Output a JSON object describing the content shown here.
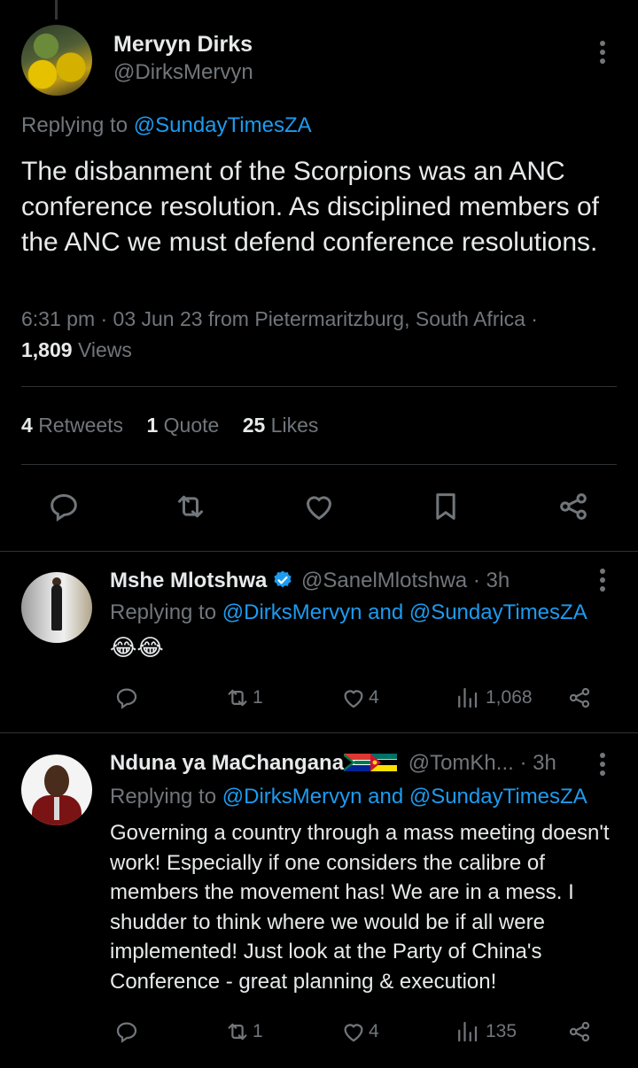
{
  "main_tweet": {
    "name": "Mervyn Dirks",
    "handle": "@DirksMervyn",
    "replying_prefix": "Replying to",
    "replying_to": "@SundayTimesZA",
    "text": "The disbanment of the Scorpions was an ANC conference resolution. As disciplined members of the ANC we must defend conference resolutions.",
    "meta": "6:31 pm · 03 Jun 23 from Pietermaritzburg, South Africa ·",
    "views_count": "1,809",
    "views_label": "Views",
    "stats": {
      "retweets_count": "4",
      "retweets_label": "Retweets",
      "quotes_count": "1",
      "quotes_label": "Quote",
      "likes_count": "25",
      "likes_label": "Likes"
    },
    "icons": [
      "reply-icon",
      "retweet-icon",
      "like-icon",
      "bookmark-icon",
      "share-icon"
    ]
  },
  "replies": [
    {
      "name": "Mshe Mlotshwa",
      "handle": "@SanelMlotshwa",
      "time": "· 3h",
      "verified": true,
      "replying_prefix": "Replying to",
      "replying_to": "@DirksMervyn and @SundayTimesZA",
      "text": "😂😂",
      "retweets": "1",
      "likes": "4",
      "views": "1,068"
    },
    {
      "name": "Nduna ya MaChangana",
      "handle": "@TomKh...",
      "time": "· 3h",
      "verified": false,
      "replying_prefix": "Replying to",
      "replying_to": "@DirksMervyn and @SundayTimesZA",
      "text": "Governing a country through a mass meeting doesn't work! Especially if one considers the calibre of members the movement has! We are in a mess. I shudder to think where we would be if all were implemented! Just look at the Party of China's Conference - great planning & execution!",
      "retweets": "1",
      "likes": "4",
      "views": "135"
    }
  ],
  "colors": {
    "background": "#000000",
    "text_primary": "#e7e9ea",
    "text_secondary": "#71767b",
    "link": "#1d9bf0",
    "divider": "#2f3336"
  }
}
